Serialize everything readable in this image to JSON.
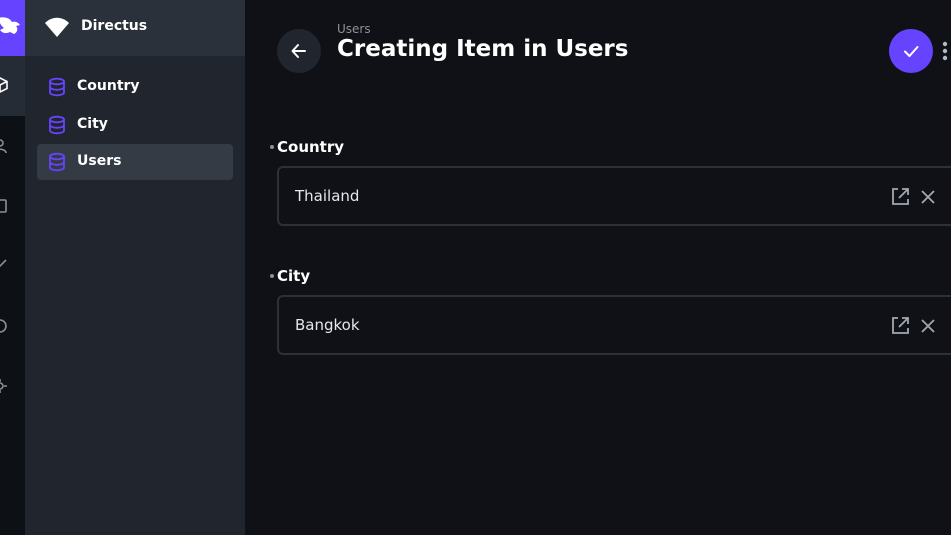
{
  "app": {
    "project_name": "Directus",
    "brand_color": "#6644ff"
  },
  "nav": {
    "items": [
      {
        "label": "Country",
        "icon": "database-icon"
      },
      {
        "label": "City",
        "icon": "database-icon"
      },
      {
        "label": "Users",
        "icon": "database-icon",
        "active": true
      }
    ]
  },
  "header": {
    "breadcrumb": "Users",
    "title": "Creating Item in Users"
  },
  "form": {
    "fields": [
      {
        "label": "Country",
        "value": "Thailand",
        "required": true
      },
      {
        "label": "City",
        "value": "Bangkok",
        "required": true
      }
    ]
  }
}
